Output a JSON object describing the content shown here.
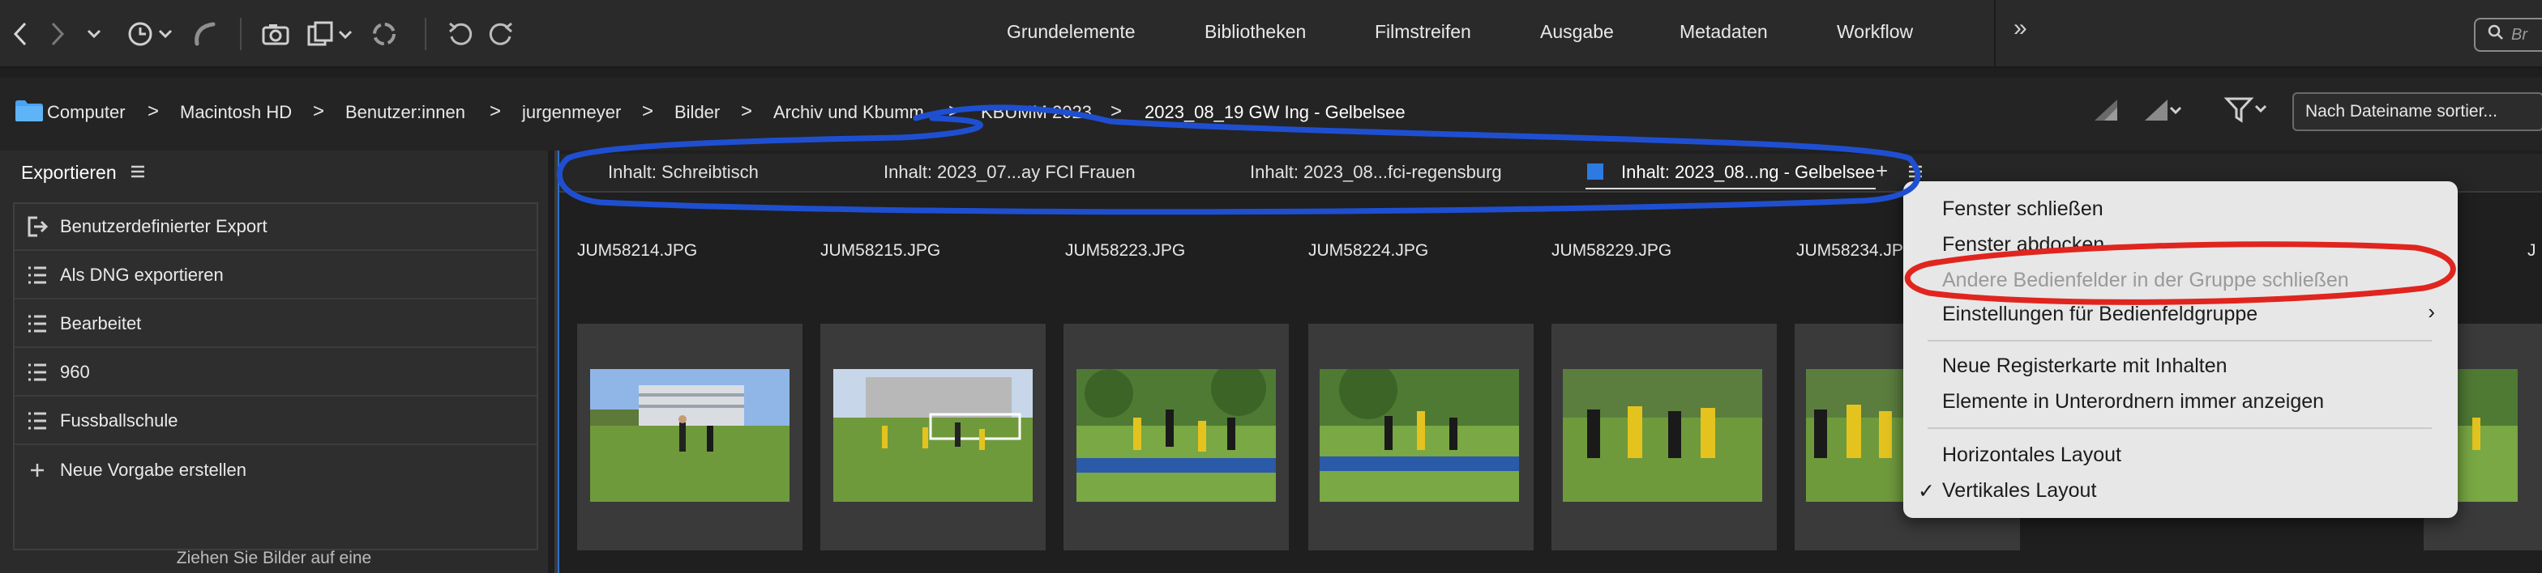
{
  "toolbar": {
    "workspaces": [
      "Grundelemente",
      "Bibliotheken",
      "Filmstreifen",
      "Ausgabe",
      "Metadaten",
      "Workflow"
    ],
    "more_label": "»",
    "search_placeholder": "Br",
    "icons": [
      "back-icon",
      "forward-icon",
      "chevron-down-icon",
      "recent-history-icon",
      "boomerang-icon",
      "camera-import-icon",
      "copy-icon",
      "refresh-icon",
      "rotate-left-icon",
      "rotate-right-icon"
    ]
  },
  "path": {
    "crumbs": [
      "Computer",
      "Macintosh HD",
      "Benutzer:innen",
      "jurgenmeyer",
      "Bilder",
      "Archiv und Kbumm",
      "KBUMM 2023",
      "2023_08_19 GW Ing - Gelbelsee"
    ],
    "separator": ">",
    "sort_label": "Nach Dateiname sortier..."
  },
  "left_panel": {
    "title": "Exportieren",
    "items": [
      {
        "label": "Benutzerdefinierter Export",
        "icon": "export-icon"
      },
      {
        "label": "Als DNG exportieren",
        "icon": "list-icon"
      },
      {
        "label": "Bearbeitet",
        "icon": "list-icon"
      },
      {
        "label": "960",
        "icon": "list-icon"
      },
      {
        "label": "Fussballschule",
        "icon": "list-icon"
      },
      {
        "label": "Neue Vorgabe erstellen",
        "icon": "plus-icon"
      }
    ],
    "drop_hint": "Ziehen Sie Bilder auf eine"
  },
  "content_tabs": [
    {
      "label": "Inhalt: Schreibtisch",
      "active": false
    },
    {
      "label": "Inhalt: 2023_07...ay FCI Frauen",
      "active": false
    },
    {
      "label": "Inhalt: 2023_08...fci-regensburg",
      "active": false
    },
    {
      "label": "Inhalt: 2023_08...ng - Gelbelsee",
      "active": true
    }
  ],
  "tab_plus": "+",
  "files": [
    "JUM58214.JPG",
    "JUM58215.JPG",
    "JUM58223.JPG",
    "JUM58224.JPG",
    "JUM58229.JPG",
    "JUM58234.JPG",
    "J"
  ],
  "context_menu": {
    "items": [
      {
        "label": "Fenster schließen",
        "enabled": true
      },
      {
        "label": "Fenster abdocken",
        "enabled": true
      },
      {
        "label": "Andere Bedienfelder in der Gruppe schließen",
        "enabled": false
      },
      {
        "label": "Einstellungen für Bedienfeldgruppe",
        "enabled": true,
        "submenu": true
      },
      {
        "label": "Neue Registerkarte mit Inhalten",
        "enabled": true
      },
      {
        "label": "Elemente in Unterordnern immer anzeigen",
        "enabled": true
      },
      {
        "label": "Horizontales Layout",
        "enabled": true
      },
      {
        "label": "Vertikales Layout",
        "enabled": true,
        "checked": true
      }
    ],
    "submenu_arrow": "›",
    "check": "✓"
  },
  "colors": {
    "accent": "#2d7be0",
    "annotation_blue": "#1f4fd1",
    "annotation_red": "#e0251f"
  }
}
